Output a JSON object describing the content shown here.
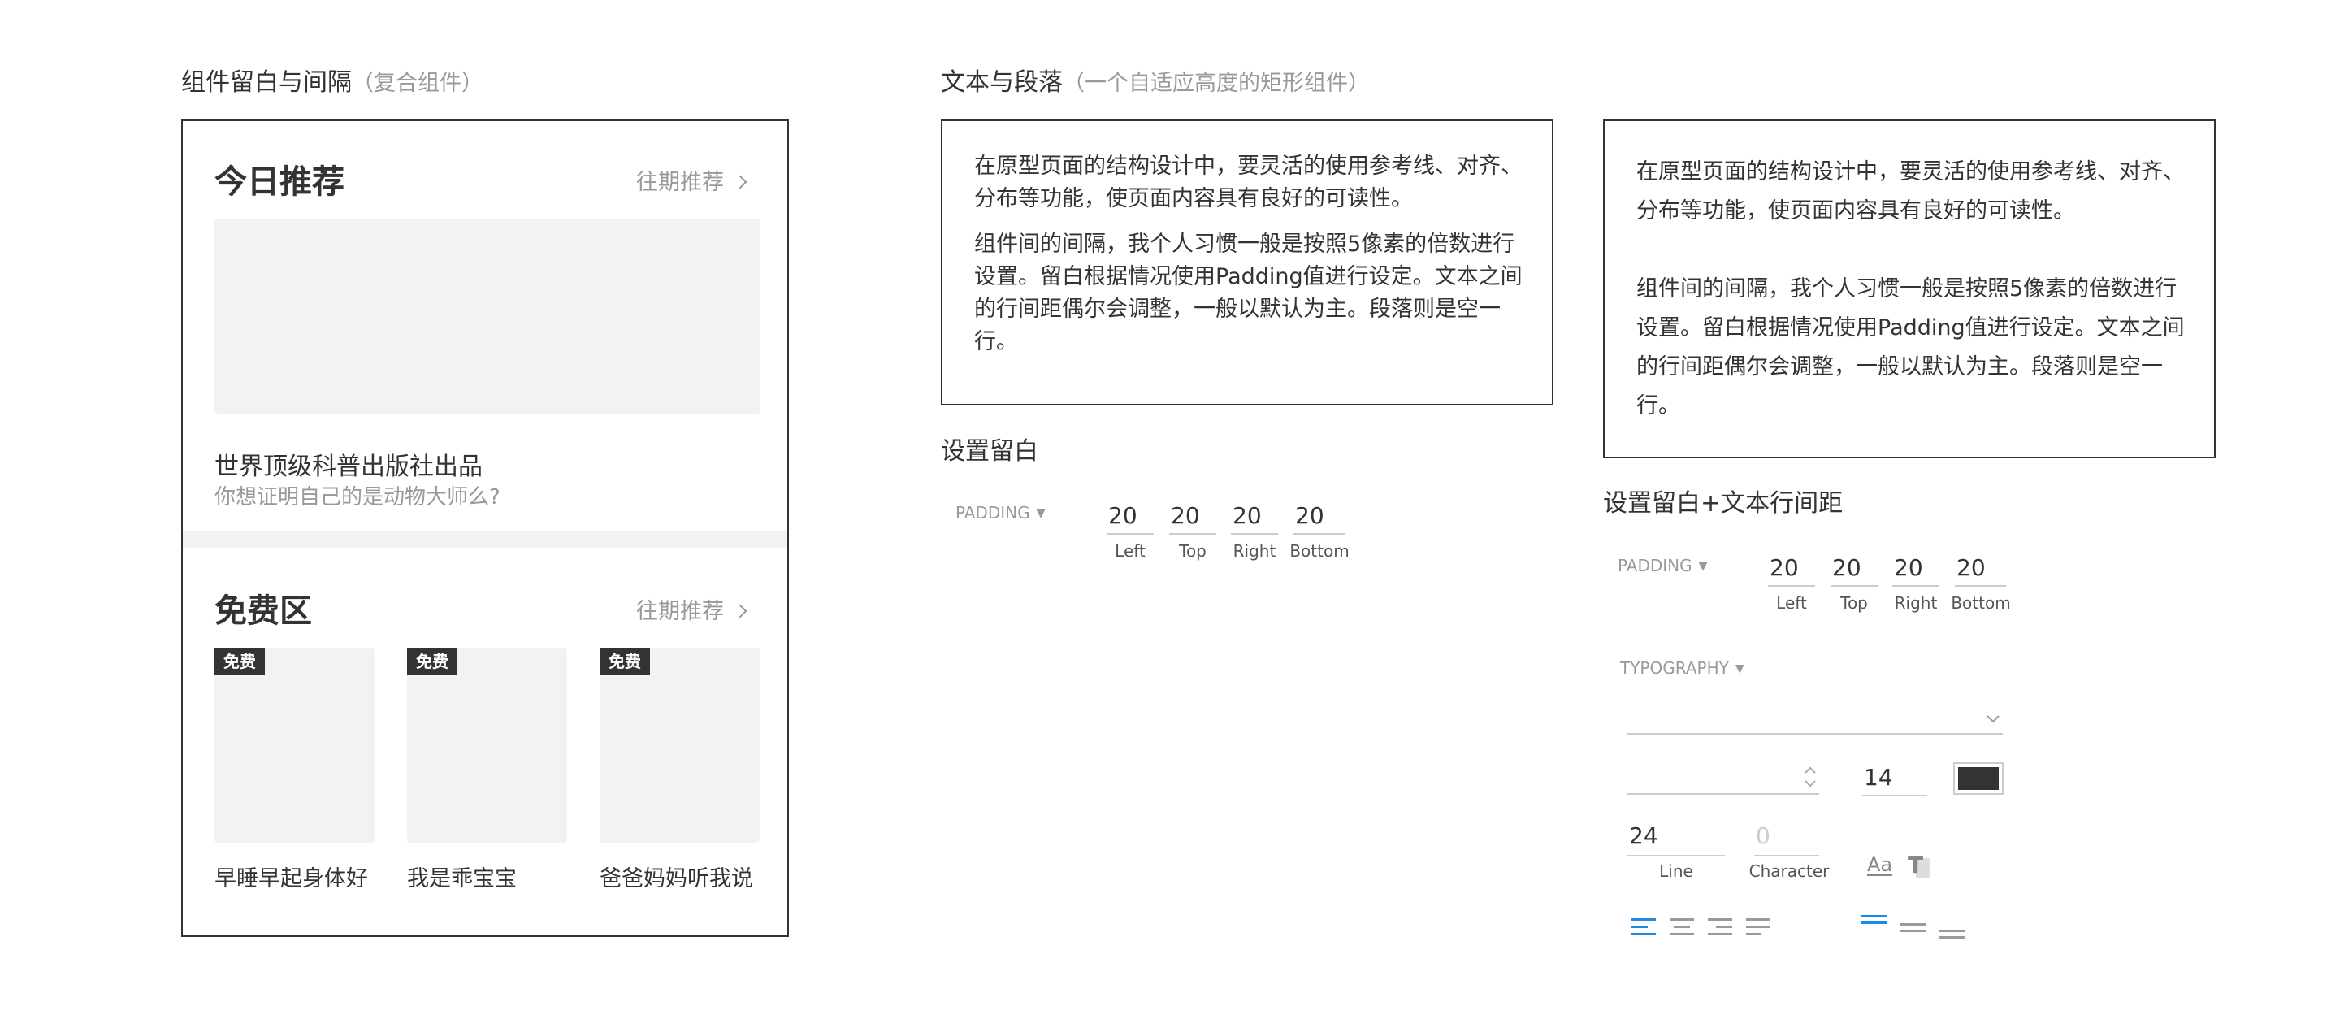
{
  "left_section": {
    "title": "组件留白与间隔",
    "subtitle": "（复合组件）"
  },
  "card": {
    "today": {
      "heading": "今日推荐",
      "more_label": "往期推荐",
      "item_title": "世界顶级科普出版社出品",
      "item_subtitle": "你想证明自己的是动物大师么?"
    },
    "free": {
      "heading": "免费区",
      "more_label": "往期推荐",
      "items": [
        {
          "tag": "免费",
          "caption": "早睡早起身体好"
        },
        {
          "tag": "免费",
          "caption": "我是乖宝宝"
        },
        {
          "tag": "免费",
          "caption": "爸爸妈妈听我说"
        }
      ]
    }
  },
  "right_section": {
    "title": "文本与段落",
    "subtitle": "（一个自适应高度的矩形组件）"
  },
  "text_box_1": {
    "para1": "在原型页面的结构设计中，要灵活的使用参考线、对齐、分布等功能，使页面内容具有良好的可读性。",
    "para2": "组件间的间隔，我个人习惯一般是按照5像素的倍数进行设置。留白根据情况使用Padding值进行设定。文本之间的行间距偶尔会调整，一般以默认为主。段落则是空一行。"
  },
  "text_box_2": {
    "para1": "在原型页面的结构设计中，要灵活的使用参考线、对齐、分布等功能，使页面内容具有良好的可读性。",
    "para2": "组件间的间隔，我个人习惯一般是按照5像素的倍数进行设置。留白根据情况使用Padding值进行设定。文本之间的行间距偶尔会调整，一般以默认为主。段落则是空一行。"
  },
  "padding_panel_1": {
    "title": "设置留白",
    "label": "PADDING",
    "fields": [
      {
        "value": "20",
        "label": "Left"
      },
      {
        "value": "20",
        "label": "Top"
      },
      {
        "value": "20",
        "label": "Right"
      },
      {
        "value": "20",
        "label": "Bottom"
      }
    ]
  },
  "padding_panel_2": {
    "title": "设置留白+文本行间距",
    "label": "PADDING",
    "fields": [
      {
        "value": "20",
        "label": "Left"
      },
      {
        "value": "20",
        "label": "Top"
      },
      {
        "value": "20",
        "label": "Right"
      },
      {
        "value": "20",
        "label": "Bottom"
      }
    ]
  },
  "typography": {
    "label": "TYPOGRAPHY",
    "font_size": "14",
    "line_value": "24",
    "line_label": "Line",
    "character_placeholder": "0",
    "character_label": "Character",
    "aa_glyph": "Aa",
    "t_glyph": "T",
    "color_text": "#333333",
    "color_active": "#1e8ae3",
    "color_inactive": "#999999"
  }
}
